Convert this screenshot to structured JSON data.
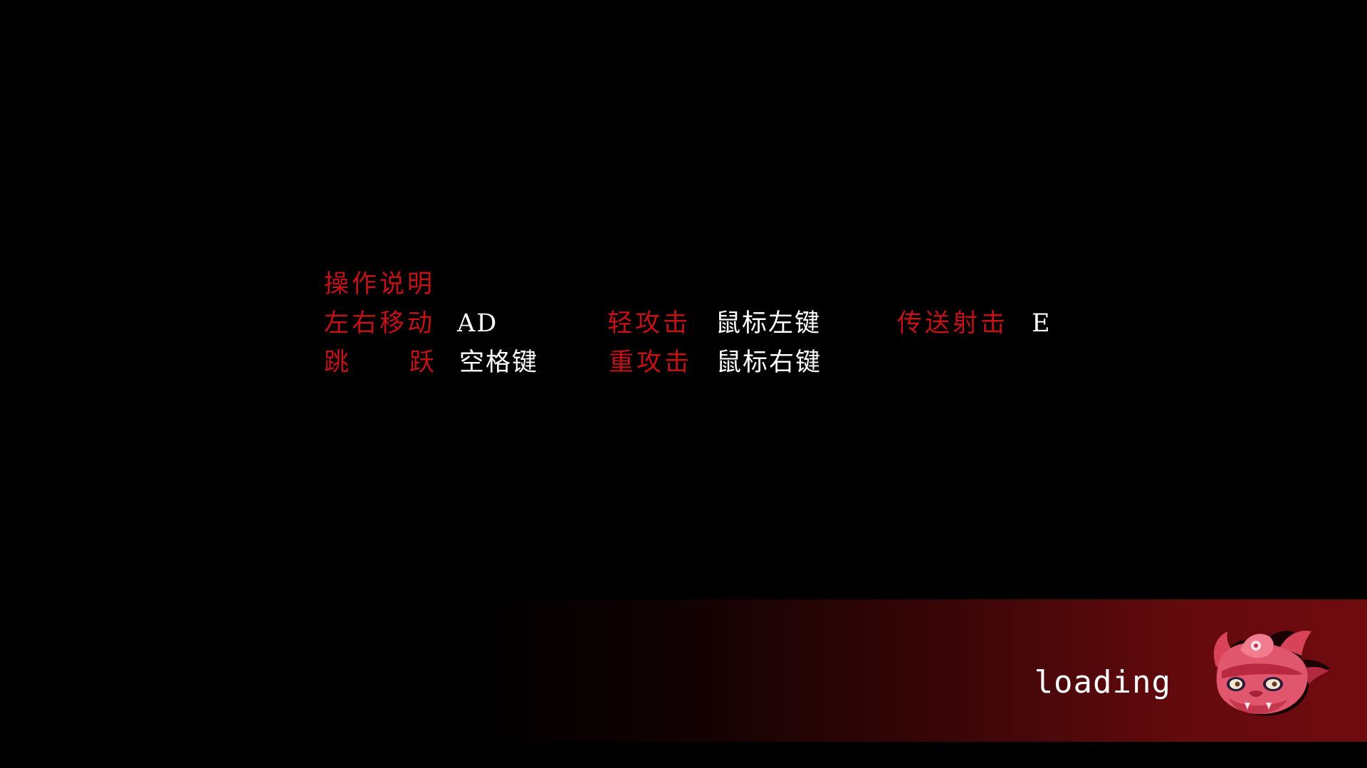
{
  "controls": {
    "title": "操作说明",
    "row1": {
      "move_label": "左右移动",
      "move_key": "AD",
      "light_attack_label": "轻攻击",
      "light_attack_key": "鼠标左键",
      "teleport_shot_label": "传送射击",
      "teleport_shot_key": "E"
    },
    "row2": {
      "jump_label_char1": "跳",
      "jump_label_char2": "跃",
      "jump_key": "空格键",
      "heavy_attack_label": "重攻击",
      "heavy_attack_key": "鼠标右键"
    }
  },
  "loading": {
    "text": "loading",
    "icon": "demon-mask-icon"
  },
  "colors": {
    "background": "#000000",
    "label": "#c21216",
    "key": "#ffffff",
    "bar_end": "#700b0e"
  }
}
